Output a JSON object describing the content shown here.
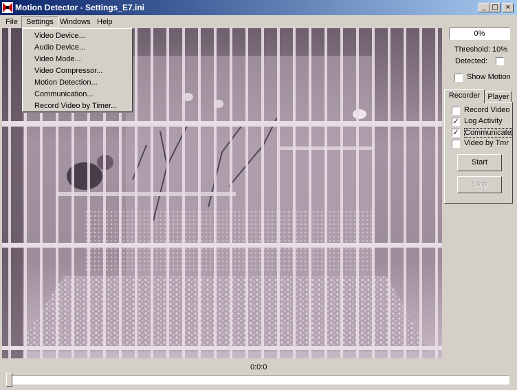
{
  "window": {
    "title": "Motion Detector - Settings_E7.ini"
  },
  "menubar": {
    "items": [
      "File",
      "Settings",
      "Windows",
      "Help"
    ]
  },
  "settings_menu": {
    "items": [
      "Video Device...",
      "Audio Device...",
      "Video Mode...",
      "Video Compressor...",
      "Motion Detection...",
      "Communication...",
      "Record Video by Timer..."
    ]
  },
  "panel": {
    "level": "0%",
    "threshold": "Threshold: 10%",
    "detected_label": "Detected:",
    "show_motion": "Show Motion",
    "tabs": [
      "Recorder",
      "Player"
    ],
    "options": [
      {
        "label": "Record Video",
        "checked": false
      },
      {
        "label": "Log Activity",
        "checked": true
      },
      {
        "label": "Communicate",
        "checked": true
      },
      {
        "label": "Video by Tmr",
        "checked": false
      }
    ],
    "start": "Start",
    "stop": "Stop"
  },
  "timeline": {
    "time": "0:0:0",
    "position": 0
  },
  "icons": {
    "app": "motion-detector-app-icon",
    "minimize": "minimize-icon",
    "maximize": "maximize-icon",
    "close": "close-icon"
  }
}
